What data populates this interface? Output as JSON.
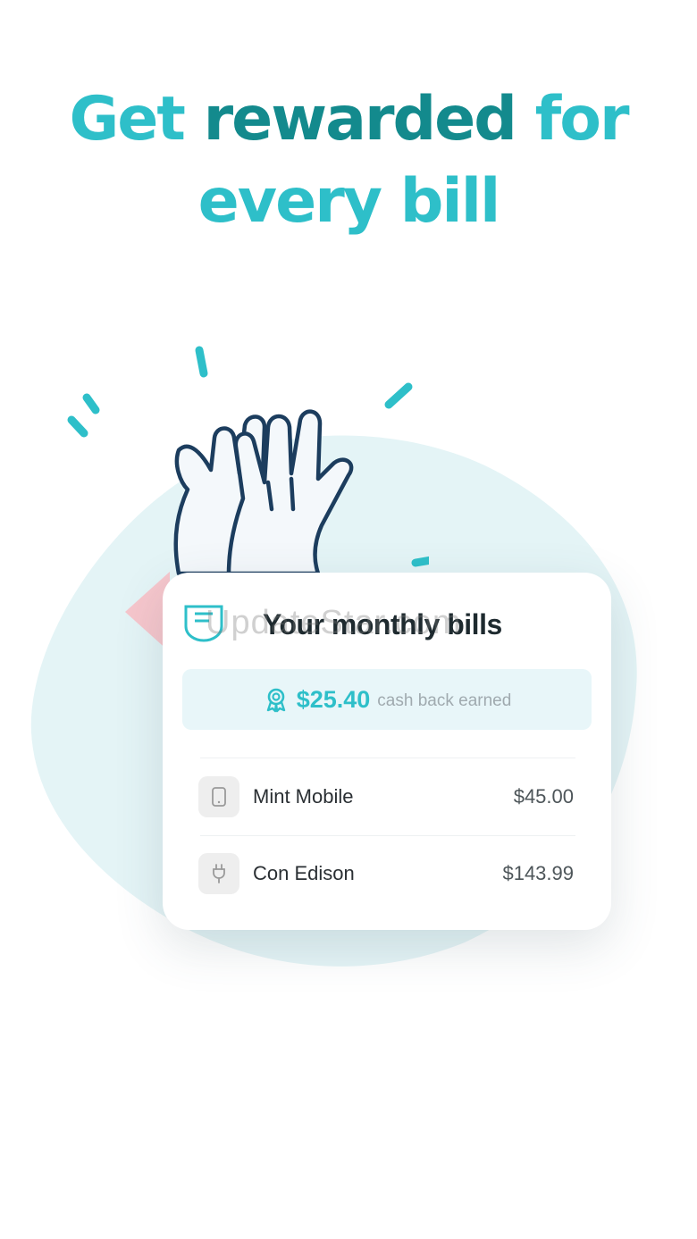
{
  "headline": {
    "line1_a": "Get ",
    "line1_b": "rewarded ",
    "line1_c": "for",
    "line2": "every bill"
  },
  "card": {
    "title": "Your monthly bills",
    "cashback_amount": "$25.40",
    "cashback_label": "cash back earned",
    "bills": [
      {
        "name": "Mint Mobile",
        "amount": "$45.00",
        "icon": "phone-icon"
      },
      {
        "name": "Con Edison",
        "amount": "$143.99",
        "icon": "plug-icon"
      }
    ]
  },
  "watermark": "UpdateStar.com",
  "colors": {
    "accent": "#2ebfc9",
    "accent_dark": "#138a8d",
    "navy_outline": "#1c3d5e",
    "blob": "#e4f4f6",
    "pink": "#f6c6cc"
  }
}
